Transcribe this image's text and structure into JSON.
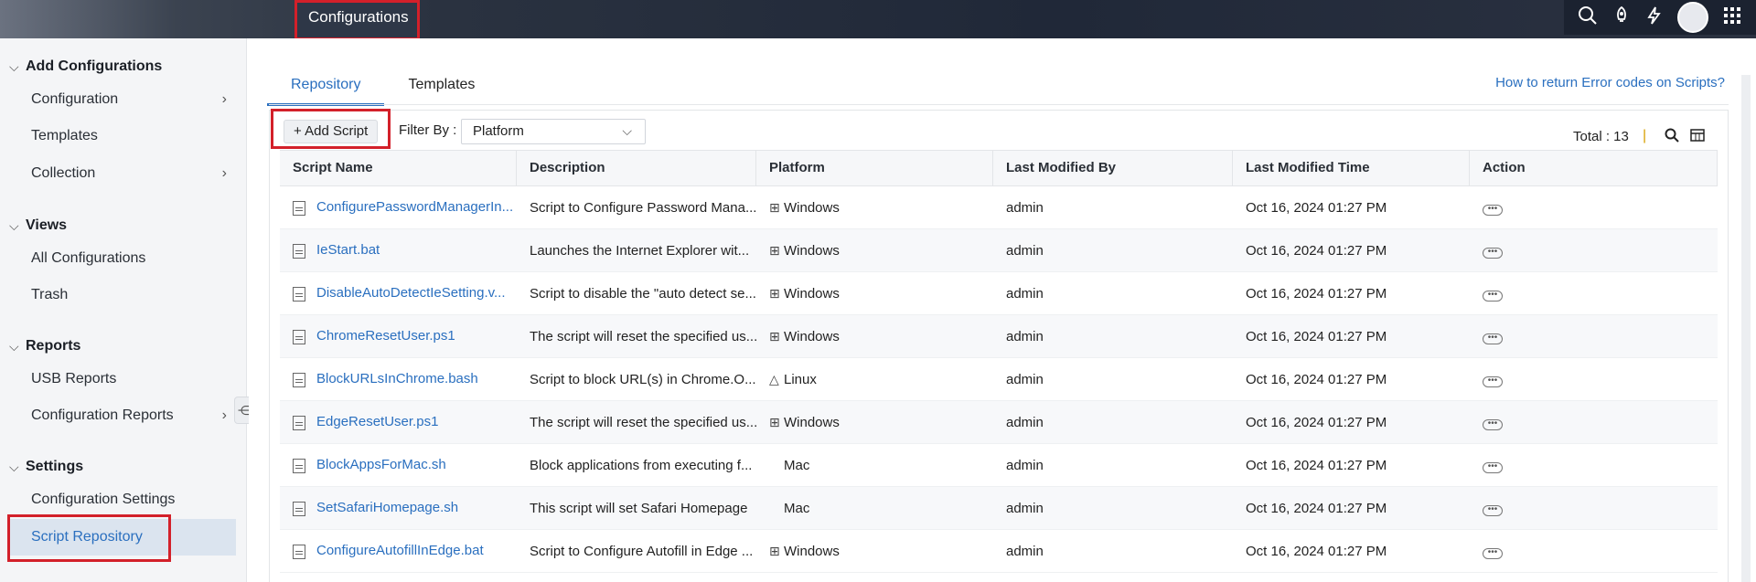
{
  "topbar": {
    "active_tab": "Configurations",
    "icons": [
      "search-icon",
      "rocket-icon",
      "lightning-icon",
      "avatar",
      "apps-grid-icon"
    ]
  },
  "sidebar": {
    "sections": [
      {
        "title": "Add Configurations",
        "items": [
          {
            "label": "Configuration",
            "has_arrow": true
          },
          {
            "label": "Templates",
            "has_arrow": false
          },
          {
            "label": "Collection",
            "has_arrow": true
          }
        ]
      },
      {
        "title": "Views",
        "items": [
          {
            "label": "All Configurations",
            "has_arrow": false
          },
          {
            "label": "Trash",
            "has_arrow": false
          }
        ]
      },
      {
        "title": "Reports",
        "items": [
          {
            "label": "USB Reports",
            "has_arrow": false
          },
          {
            "label": "Configuration Reports",
            "has_arrow": true
          }
        ]
      },
      {
        "title": "Settings",
        "items": [
          {
            "label": "Configuration Settings",
            "has_arrow": false
          },
          {
            "label": "Script Repository",
            "has_arrow": false,
            "active": true
          }
        ]
      }
    ]
  },
  "main": {
    "tabs": [
      "Repository",
      "Templates"
    ],
    "active_tab": "Repository",
    "help_link": "How to return Error codes on Scripts?",
    "add_script_label": "+ Add Script",
    "filter_label": "Filter By :",
    "filter_value": "Platform",
    "total_label": "Total : 13"
  },
  "table": {
    "columns": [
      "Script Name",
      "Description",
      "Platform",
      "Last Modified By",
      "Last Modified Time",
      "Action"
    ],
    "rows": [
      {
        "name": "ConfigurePasswordManagerIn...",
        "description": "Script to Configure Password Mana...",
        "platform": "Windows",
        "platform_icon": "windows-icon",
        "modified_by": "admin",
        "modified_time": "Oct 16, 2024 01:27 PM"
      },
      {
        "name": "IeStart.bat",
        "description": "Launches the Internet Explorer wit...",
        "platform": "Windows",
        "platform_icon": "windows-icon",
        "modified_by": "admin",
        "modified_time": "Oct 16, 2024 01:27 PM"
      },
      {
        "name": "DisableAutoDetectIeSetting.v...",
        "description": "Script to disable the \"auto detect se...",
        "platform": "Windows",
        "platform_icon": "windows-icon",
        "modified_by": "admin",
        "modified_time": "Oct 16, 2024 01:27 PM"
      },
      {
        "name": "ChromeResetUser.ps1",
        "description": "The script will reset the specified us...",
        "platform": "Windows",
        "platform_icon": "windows-icon",
        "modified_by": "admin",
        "modified_time": "Oct 16, 2024 01:27 PM"
      },
      {
        "name": "BlockURLsInChrome.bash",
        "description": "Script to block URL(s) in Chrome.O...",
        "platform": "Linux",
        "platform_icon": "linux-icon",
        "modified_by": "admin",
        "modified_time": "Oct 16, 2024 01:27 PM"
      },
      {
        "name": "EdgeResetUser.ps1",
        "description": "The script will reset the specified us...",
        "platform": "Windows",
        "platform_icon": "windows-icon",
        "modified_by": "admin",
        "modified_time": "Oct 16, 2024 01:27 PM"
      },
      {
        "name": "BlockAppsForMac.sh",
        "description": "Block applications from executing f...",
        "platform": "Mac",
        "platform_icon": "apple-icon",
        "modified_by": "admin",
        "modified_time": "Oct 16, 2024 01:27 PM"
      },
      {
        "name": "SetSafariHomepage.sh",
        "description": "This script will set Safari Homepage",
        "platform": "Mac",
        "platform_icon": "apple-icon",
        "modified_by": "admin",
        "modified_time": "Oct 16, 2024 01:27 PM"
      },
      {
        "name": "ConfigureAutofillInEdge.bat",
        "description": "Script to Configure Autofill in Edge ...",
        "platform": "Windows",
        "platform_icon": "windows-icon",
        "modified_by": "admin",
        "modified_time": "Oct 16, 2024 01:27 PM"
      }
    ]
  },
  "colors": {
    "accent": "#2a6fbf",
    "highlight_border": "#d3202a",
    "sidebar_bg": "#f4f5f7",
    "active_item_bg": "#dbe4ef"
  }
}
